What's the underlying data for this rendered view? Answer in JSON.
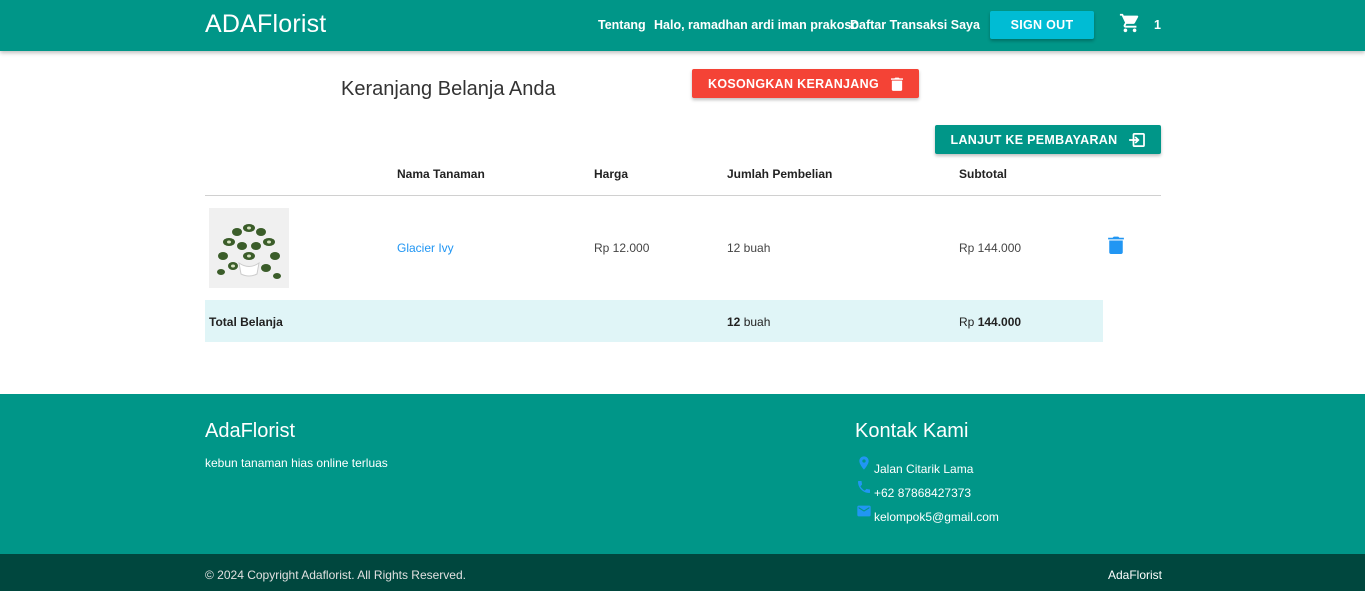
{
  "navbar": {
    "brand": "ADAFlorist",
    "links": [
      "Tentang",
      "Halo, ramadhan ardi iman prakoso",
      "Daftar Transaksi Saya"
    ],
    "signout_label": "SIGN OUT",
    "cart_count": "1",
    "cart_icon": "shopping-cart-icon"
  },
  "cart": {
    "title": "Keranjang Belanja Anda",
    "empty_button": "KOSONGKAN KERANJANG",
    "checkout_button": "LANJUT KE PEMBAYARAN",
    "headers": [
      "Nama Tanaman",
      "Harga",
      "Jumlah Pembelian",
      "Subtotal"
    ],
    "items": [
      {
        "name": "Glacier Ivy",
        "price": "Rp 12.000",
        "quantity": "12 buah",
        "subtotal": "Rp 144.000"
      }
    ],
    "total": {
      "label": "Total Belanja",
      "qty_number": "12",
      "qty_unit": "buah",
      "currency": "Rp",
      "amount": "144.000"
    }
  },
  "footer": {
    "brand": "AdaFlorist",
    "tagline": "kebun tanaman hias online terluas",
    "contact_title": "Kontak Kami",
    "address": "Jalan Citarik Lama",
    "phone": "+62 87868427373",
    "email": "kelompok5@gmail.com",
    "copyright": "© 2024 Copyright Adaflorist. All Rights Reserved.",
    "bottom_brand": "AdaFlorist"
  },
  "colors": {
    "primary": "#009688",
    "accent": "#00bcd4",
    "danger": "#f44336",
    "link": "#2196f3",
    "footer_dark": "#00473e",
    "total_row": "#e0f5f7"
  }
}
